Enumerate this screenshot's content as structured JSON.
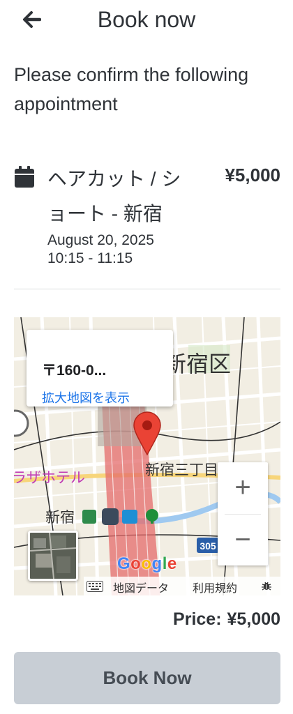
{
  "header": {
    "title": "Book now",
    "back_icon": "arrow-left-icon"
  },
  "confirm_text": "Please confirm the following appointment",
  "appointment": {
    "icon": "calendar-icon",
    "service": "ヘアカット / ショート - 新宿",
    "price": "¥5,000",
    "date": "August 20, 2025",
    "time": "10:15 - 11:15"
  },
  "map": {
    "info_postal": "〒160-0...",
    "info_link": "拡大地図を表示",
    "labels": {
      "ward": "新宿区",
      "sanchome": "新宿三丁目",
      "station": "新宿",
      "hotel": "ラザホテル",
      "route": "305"
    },
    "zoom_in": "+",
    "zoom_out": "−",
    "footer": {
      "map_data": "地図データ",
      "terms": "利用規約"
    },
    "google": [
      "G",
      "o",
      "o",
      "g",
      "l",
      "e"
    ],
    "colors": {
      "pin": "#ea4335",
      "rail": "#e46b6b",
      "water": "#9fc9f0"
    }
  },
  "price_row": {
    "label": "Price:",
    "value": "¥5,000"
  },
  "book_button": "Book Now"
}
